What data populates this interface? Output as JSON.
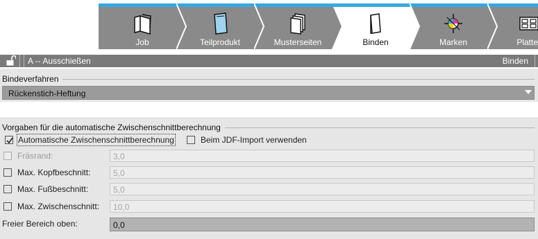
{
  "tabs": [
    {
      "label": "Job",
      "icon": "folder-icon",
      "active": false
    },
    {
      "label": "Teilprodukt",
      "icon": "sheet-icon",
      "active": false
    },
    {
      "label": "Musterseiten",
      "icon": "pages-stack-icon",
      "active": false
    },
    {
      "label": "Binden",
      "icon": "binding-icon",
      "active": true
    },
    {
      "label": "Marken",
      "icon": "registration-mark-icon",
      "active": false
    },
    {
      "label": "Platte",
      "icon": "plate-icon",
      "active": false
    }
  ],
  "titlebar": {
    "job": "A -- Ausschießen",
    "module": "Binden"
  },
  "bindeverfahren": {
    "title": "Bindeverfahren",
    "selected": "Rückenstich-Heftung"
  },
  "vorgaben": {
    "title": "Vorgaben für die automatische Zwischenschnittberechnung",
    "auto_label": "Automatische Zwischenschnittberechnung",
    "auto_checked": true,
    "jdf_label": "Beim JDF-Import verwenden",
    "jdf_checked": false,
    "rows": [
      {
        "label": "Fräsrand:",
        "value": "3,0",
        "checked": false,
        "disabled": true
      },
      {
        "label": "Max. Kopfbeschnitt:",
        "value": "5,0",
        "checked": false,
        "disabled": false
      },
      {
        "label": "Max. Fußbeschnitt:",
        "value": "5,0",
        "checked": false,
        "disabled": false
      },
      {
        "label": "Max. Zwischenschnitt:",
        "value": "10,0",
        "checked": false,
        "disabled": false
      }
    ],
    "freier_label": "Freier Bereich oben:",
    "freier_value": "0,0"
  },
  "colors": {
    "tab_gray": "#8a8a8a",
    "tab_active": "#ffffff",
    "accent_blue": "#35a8e0",
    "titlebar": "#7a7a7a",
    "panel": "#e6e6e6"
  }
}
